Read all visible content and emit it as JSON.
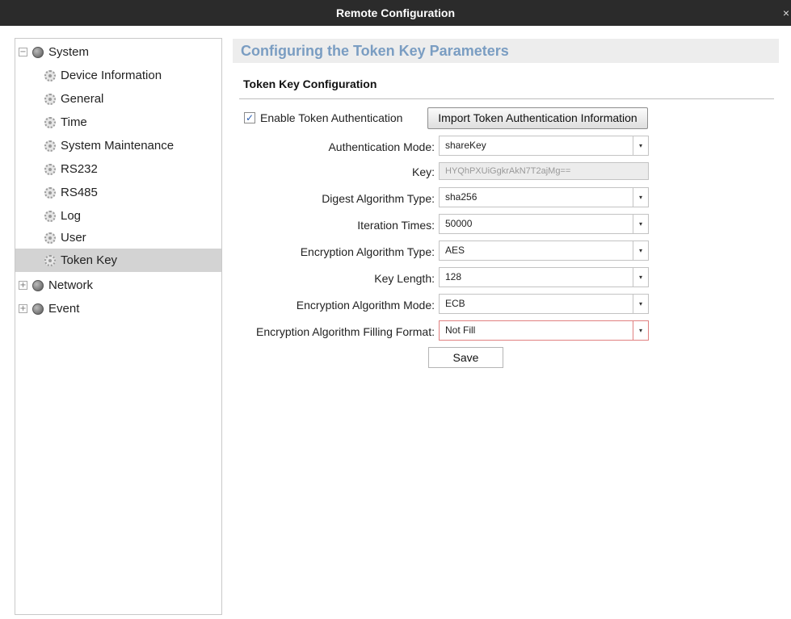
{
  "window": {
    "title": "Remote Configuration",
    "close_glyph": "×"
  },
  "sidebar": {
    "items": [
      {
        "label": "System",
        "expander": "−",
        "icon": "globe-icon"
      },
      {
        "label": "Device Information",
        "icon": "gear-icon"
      },
      {
        "label": "General",
        "icon": "gear-icon"
      },
      {
        "label": "Time",
        "icon": "gear-icon"
      },
      {
        "label": "System Maintenance",
        "icon": "gear-icon"
      },
      {
        "label": "RS232",
        "icon": "gear-icon"
      },
      {
        "label": "RS485",
        "icon": "gear-icon"
      },
      {
        "label": "Log",
        "icon": "gear-icon"
      },
      {
        "label": "User",
        "icon": "gear-icon"
      },
      {
        "label": "Token Key",
        "icon": "gear-icon",
        "selected": true
      },
      {
        "label": "Network",
        "expander": "+",
        "icon": "globe-icon"
      },
      {
        "label": "Event",
        "expander": "+",
        "icon": "globe-icon"
      }
    ]
  },
  "main": {
    "header": "Configuring the Token Key Parameters",
    "section_title": "Token Key Configuration",
    "enable_checkbox": {
      "label": "Enable Token Authentication",
      "checked": true,
      "glyph": "✓"
    },
    "import_button": "Import Token Authentication Information",
    "fields": {
      "auth_mode": {
        "label": "Authentication Mode:",
        "value": "shareKey"
      },
      "key": {
        "label": "Key:",
        "value": "HYQhPXUiGgkrAkN7T2ajMg=="
      },
      "digest": {
        "label": "Digest Algorithm Type:",
        "value": "sha256"
      },
      "iteration": {
        "label": "Iteration Times:",
        "value": "50000"
      },
      "enc_type": {
        "label": "Encryption Algorithm Type:",
        "value": "AES"
      },
      "key_length": {
        "label": "Key Length:",
        "value": "128"
      },
      "enc_mode": {
        "label": "Encryption Algorithm Mode:",
        "value": "ECB"
      },
      "filling": {
        "label": "Encryption Algorithm Filling Format:",
        "value": "Not Fill"
      }
    },
    "dropdown_arrow": "▾",
    "save_button": "Save"
  },
  "colors": {
    "titlebar": "#2b2b2b",
    "header_text": "#7a9dc2",
    "selected_row": "#d3d3d3",
    "invalid_border": "#e08080"
  }
}
